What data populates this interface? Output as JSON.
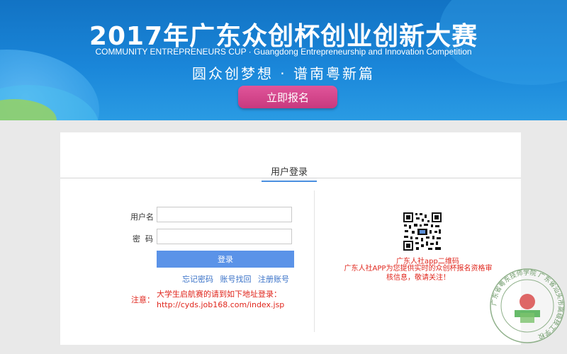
{
  "banner": {
    "title": "2017年广东众创杯创业创新大赛",
    "subtitle": "COMMUNITY ENTREPRENEURS CUP · Guangdong Entrepreneurship and Innovation Competition",
    "slogan": "圆众创梦想  ·  谱南粤新篇",
    "signup_label": "立即报名"
  },
  "login": {
    "tab_label": "用户登录",
    "username_label": "用户名",
    "username_value": "",
    "password_label": "密  码",
    "password_value": "",
    "submit_label": "登录",
    "links": {
      "forgot_password": "忘记密码",
      "recover_account": "账号找回",
      "register": "注册账号"
    },
    "notice_label": "注意：",
    "notice_line1": "大学生启航赛的请到如下地址登录：",
    "notice_line2": "http://cyds.job168.com/index.jsp"
  },
  "qr": {
    "title": "广东人社app二维码",
    "description": "广东人社APP为您提供实时的众创杯报名资格审核信息，敬请关注！"
  },
  "seal": {
    "text": "广东省粤东技师学院 广东省汕头市高级技工学校"
  },
  "colors": {
    "banner_blue": "#1a86d9",
    "signup_pink": "#d4458a",
    "login_blue": "#5b93e8",
    "notice_red": "#e0261c",
    "link_blue": "#3b73c8"
  }
}
